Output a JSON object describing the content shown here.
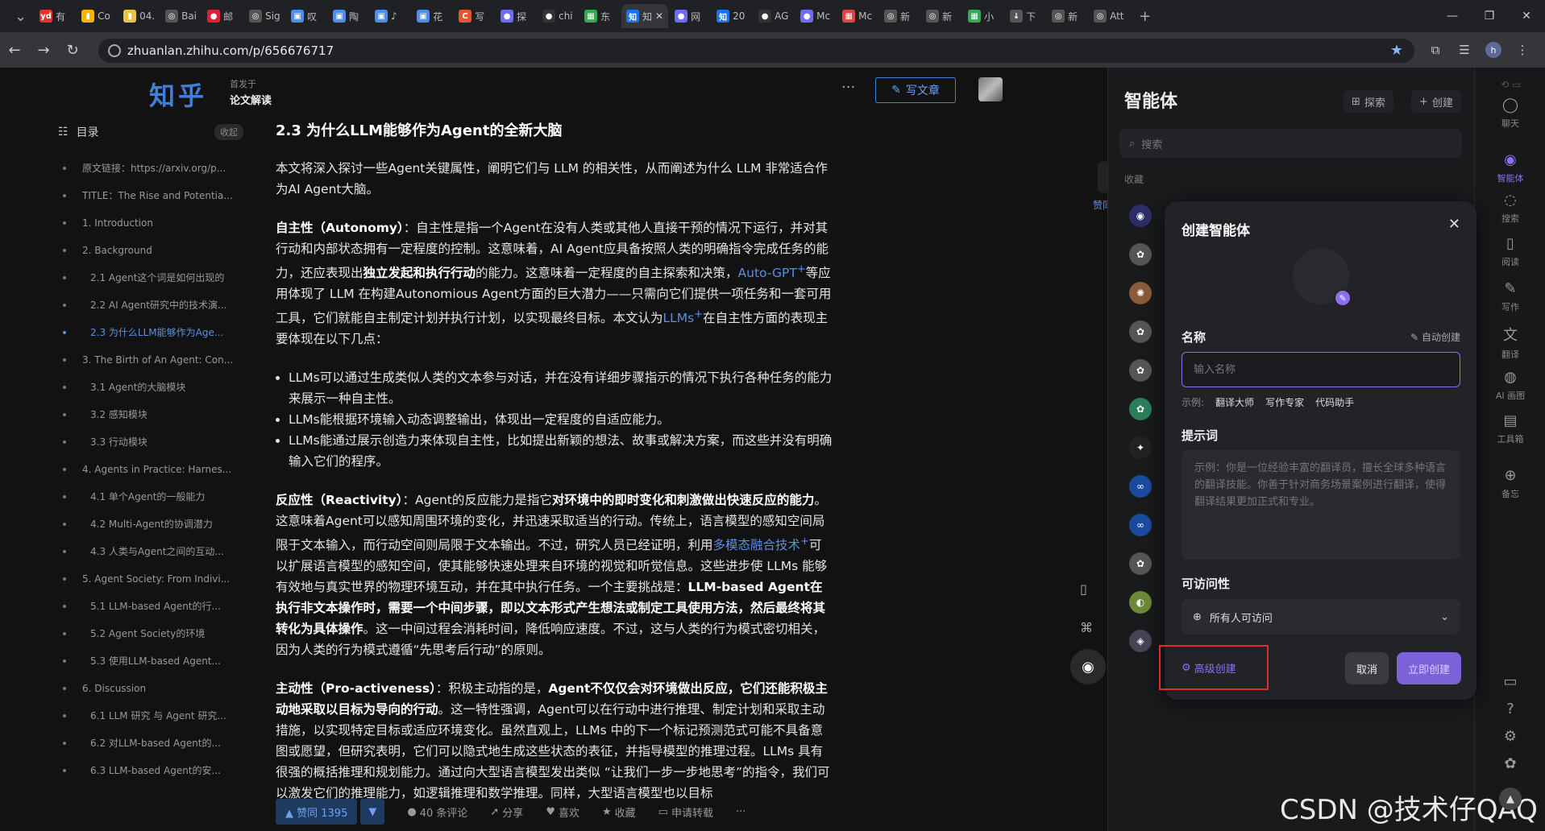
{
  "browser": {
    "tabs": [
      {
        "label": "有",
        "fav": "yd",
        "color": "#e8322b"
      },
      {
        "label": "Co",
        "fav": "▮",
        "color": "#f5b400"
      },
      {
        "label": "04.",
        "fav": "▮",
        "color": "#e8c547"
      },
      {
        "label": "Bai",
        "fav": "◎",
        "color": "#555"
      },
      {
        "label": "邮",
        "fav": "●",
        "color": "#d23"
      },
      {
        "label": "Sig",
        "fav": "◎",
        "color": "#555"
      },
      {
        "label": "叹",
        "fav": "▣",
        "color": "#4a8ef0"
      },
      {
        "label": "陶",
        "fav": "▣",
        "color": "#4a8ef0"
      },
      {
        "label": "♪",
        "fav": "▣",
        "color": "#4a8ef0"
      },
      {
        "label": "花",
        "fav": "▣",
        "color": "#4a8ef0"
      },
      {
        "label": "写",
        "fav": "C",
        "color": "#e8542b"
      },
      {
        "label": "探",
        "fav": "●",
        "color": "#6d6df0"
      },
      {
        "label": "chi",
        "fav": "●",
        "color": "#333"
      },
      {
        "label": "东",
        "fav": "▦",
        "color": "#3a5"
      },
      {
        "label": "知",
        "fav": "知",
        "color": "#1772f6"
      },
      {
        "label": "网",
        "fav": "●",
        "color": "#6d6df0"
      },
      {
        "label": "20",
        "fav": "知",
        "color": "#1772f6"
      },
      {
        "label": "AG",
        "fav": "●",
        "color": "#333"
      },
      {
        "label": "Mc",
        "fav": "●",
        "color": "#6d6df0"
      },
      {
        "label": "Mc",
        "fav": "▦",
        "color": "#d44"
      },
      {
        "label": "新",
        "fav": "◎",
        "color": "#555"
      },
      {
        "label": "新",
        "fav": "◎",
        "color": "#555"
      },
      {
        "label": "小",
        "fav": "▦",
        "color": "#3a5"
      },
      {
        "label": "下",
        "fav": "↓",
        "color": "#555"
      },
      {
        "label": "新",
        "fav": "◎",
        "color": "#555"
      },
      {
        "label": "Att",
        "fav": "◎",
        "color": "#555"
      }
    ],
    "active_tab_index": 14,
    "url": "zhuanlan.zhihu.com/p/656676717"
  },
  "header": {
    "logo": "知乎",
    "pub_from": "首发于",
    "column": "论文解读",
    "write_label": "写文章"
  },
  "toc": {
    "title": "目录",
    "fold_label": "收起",
    "items": [
      {
        "label": "原文链接：https://arxiv.org/p...",
        "sub": false,
        "active": false
      },
      {
        "label": "TITLE：The Rise and Potentia...",
        "sub": false,
        "active": false
      },
      {
        "label": "1. Introduction",
        "sub": false,
        "active": false
      },
      {
        "label": "2. Background",
        "sub": false,
        "active": false
      },
      {
        "label": "2.1 Agent这个词是如何出现的",
        "sub": true,
        "active": false
      },
      {
        "label": "2.2 AI Agent研究中的技术演...",
        "sub": true,
        "active": false
      },
      {
        "label": "2.3 为什么LLM能够作为Age...",
        "sub": true,
        "active": true
      },
      {
        "label": "3. The Birth of An Agent: Con...",
        "sub": false,
        "active": false
      },
      {
        "label": "3.1 Agent的大脑模块",
        "sub": true,
        "active": false
      },
      {
        "label": "3.2 感知模块",
        "sub": true,
        "active": false
      },
      {
        "label": "3.3 行动模块",
        "sub": true,
        "active": false
      },
      {
        "label": "4. Agents in Practice: Harnes...",
        "sub": false,
        "active": false
      },
      {
        "label": "4.1 单个Agent的一般能力",
        "sub": true,
        "active": false
      },
      {
        "label": "4.2 Multi-Agent的协调潜力",
        "sub": true,
        "active": false
      },
      {
        "label": "4.3 人类与Agent之间的互动...",
        "sub": true,
        "active": false
      },
      {
        "label": "5. Agent Society: From Indivi...",
        "sub": false,
        "active": false
      },
      {
        "label": "5.1 LLM-based Agent的行...",
        "sub": true,
        "active": false
      },
      {
        "label": "5.2 Agent Society的环境",
        "sub": true,
        "active": false
      },
      {
        "label": "5.3 使用LLM-based Agent...",
        "sub": true,
        "active": false
      },
      {
        "label": "6. Discussion",
        "sub": false,
        "active": false
      },
      {
        "label": "6.1 LLM 研究 与 Agent 研究...",
        "sub": true,
        "active": false
      },
      {
        "label": "6.2 对LLM-based Agent的...",
        "sub": true,
        "active": false
      },
      {
        "label": "6.3 LLM-based Agent的安...",
        "sub": true,
        "active": false
      }
    ]
  },
  "article": {
    "heading": "2.3 为什么LLM能够作为Agent的全新大脑",
    "intro": "本文将深入探讨一些Agent关键属性，阐明它们与 LLM 的相关性，从而阐述为什么 LLM 非常适合作为AI Agent大脑。",
    "autonomy": {
      "term": "自主性（Autonomy）",
      "t1": "：自主性是指一个Agent在没有人类或其他人直接干预的情况下运行，并对其行动和内部状态拥有一定程度的控制。这意味着，AI Agent应具备按照人类的明确指令完成任务的能力，还应表现出",
      "b1": "独立发起和执行行动",
      "t2": "的能力。这意味着一定程度的自主探索和决策，",
      "link1": "Auto-GPT",
      "t3": "等应用体现了 LLM 在构建Autonomious Agent方面的巨大潜力——只需向它们提供一项任务和一套可用工具，它们就能自主制定计划并执行计划，以实现最终目标。本文认为",
      "link2": "LLMs",
      "t4": "在自主性方面的表现主要体现在以下几点："
    },
    "bullets": [
      "LLMs可以通过生成类似人类的文本参与对话，并在没有详细步骤指示的情况下执行各种任务的能力来展示一种自主性。",
      "LLMs能根据环境输入动态调整输出，体现出一定程度的自适应能力。",
      "LLMs能通过展示创造力来体现自主性，比如提出新颖的想法、故事或解决方案，而这些并没有明确输入它们的程序。"
    ],
    "reactivity": {
      "term": "反应性（Reactivity）",
      "t1": "：Agent的反应能力是指它",
      "b1": "对环境中的即时变化和刺激做出快速反应的能力",
      "t2": "。这意味着Agent可以感知周围环境的变化，并迅速采取适当的行动。传统上，语言模型的感知空间局限于文本输入，而行动空间则局限于文本输出。不过，研究人员已经证明，利用",
      "link1": "多模态融合技术",
      "t3": "可以扩展语言模型的感知空间，使其能够快速处理来自环境的视觉和听觉信息。这些进步使 LLMs 能够有效地与真实世界的物理环境互动，并在其中执行任务。一个主要挑战是：",
      "b2": "LLM-based Agent在执行非文本操作时，需要一个中间步骤，即以文本形式产生想法或制定工具使用方法，然后最终将其转化为具体操作",
      "t4": "。这一中间过程会消耗时间，降低响应速度。不过，这与人类的行为模式密切相关，因为人类的行为模式遵循“先思考后行动”的原则。"
    },
    "proactive": {
      "term": "主动性（Pro-activeness）",
      "t1": "：积极主动指的是，",
      "b1": "Agent不仅仅会对环境做出反应，它们还能积极主动地采取以目标为导向的行动",
      "t2": "。这一特性强调，Agent可以在行动中进行推理、制定计划和采取主动措施，以实现特定目标或适应环境变化。虽然直观上，LLMs 中的下一个标记预测范式可能不具备意图或愿望，但研究表明，它们可以隐式地生成这些状态的表征，并指导模型的推理过程。LLMs 具有很强的概括推理和规划能力。通过向大型语言模型发出类似 “让我们一步一步地思考”的指令，我们可以激发它们的推理能力，如逻辑推理和数学推理。同样，大型语言模型也以目标"
    }
  },
  "actions": {
    "vote": "▲ 赞同 1395",
    "comments": "40 条评论",
    "share": "分享",
    "like": "喜欢",
    "collect": "收藏",
    "repost": "申请转载",
    "more": "···"
  },
  "float": {
    "zan": "赞同"
  },
  "panel": {
    "title": "智能体",
    "explore": "探索",
    "create": "创建",
    "search_placeholder": "搜索",
    "favorites": "收藏",
    "items": [
      {
        "color": "#2d2d6a",
        "glyph": "◉"
      },
      {
        "color": "#555",
        "glyph": "✿"
      },
      {
        "color": "#8a5a3a",
        "glyph": "✺"
      },
      {
        "color": "#555",
        "glyph": "✿"
      },
      {
        "color": "#555",
        "glyph": "✿"
      },
      {
        "color": "#2e7d5a",
        "glyph": "✿"
      },
      {
        "color": "#222",
        "glyph": "✦"
      },
      {
        "color": "#1a4aa0",
        "glyph": "∞"
      },
      {
        "color": "#1a4aa0",
        "glyph": "∞"
      },
      {
        "color": "#555",
        "glyph": "✿"
      },
      {
        "color": "#6a8a3a",
        "glyph": "◐"
      },
      {
        "color": "#445",
        "glyph": "◈"
      }
    ]
  },
  "rail": {
    "items": [
      {
        "icon": "◯",
        "label": "聊天",
        "active": false
      },
      {
        "icon": "◉",
        "label": "智能体",
        "active": true
      },
      {
        "icon": "◌",
        "label": "搜索",
        "active": false
      },
      {
        "icon": "▯",
        "label": "阅读",
        "active": false
      },
      {
        "icon": "✎",
        "label": "写作",
        "active": false
      },
      {
        "icon": "文",
        "label": "翻译",
        "active": false
      },
      {
        "icon": "◍",
        "label": "AI 画图",
        "active": false
      },
      {
        "icon": "▤",
        "label": "工具箱",
        "active": false
      },
      {
        "icon": "⊕",
        "label": "备忘",
        "active": false
      }
    ]
  },
  "dialog": {
    "title": "创建智能体",
    "name_label": "名称",
    "auto_create": "自动创建",
    "name_placeholder": "输入名称",
    "examples_prefix": "示例:",
    "examples": [
      "翻译大师",
      "写作专家",
      "代码助手"
    ],
    "prompt_label": "提示词",
    "prompt_placeholder": "示例：你是一位经验丰富的翻译员，擅长全球多种语言的翻译技能。你善于针对商务场景案例进行翻译，使得翻译结果更加正式和专业。",
    "visibility_label": "可访问性",
    "visibility_value": "所有人可访问",
    "advanced": "高级创建",
    "cancel": "取消",
    "submit": "立即创建"
  },
  "watermark": "CSDN @技术仔QAQ"
}
